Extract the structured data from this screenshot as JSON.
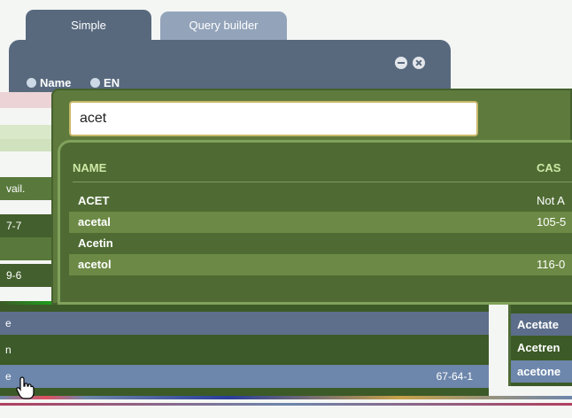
{
  "tabs": [
    {
      "label": "Simple",
      "active": true
    },
    {
      "label": "Query builder",
      "active": false
    }
  ],
  "panel": {
    "radio_options": [
      "Name",
      "EN"
    ],
    "minimize_icon": "minus-circle-icon",
    "close_icon": "close-circle-icon"
  },
  "search": {
    "value": "acet"
  },
  "results": {
    "columns": [
      "NAME",
      "CAS"
    ],
    "rows": [
      {
        "name": "ACET",
        "cas": "Not A"
      },
      {
        "name": "acetal",
        "cas": "105-5"
      },
      {
        "name": "Acetin",
        "cas": ""
      },
      {
        "name": "acetol",
        "cas": "116-0"
      }
    ]
  },
  "background_table": {
    "left_cells": [
      "vail.",
      "7-7",
      "",
      "9-6"
    ]
  },
  "bottom_left": {
    "rows": [
      {
        "left": "e",
        "right": ""
      },
      {
        "left": "n",
        "right": ""
      },
      {
        "left": "e",
        "right": "67-64-1"
      }
    ]
  },
  "bottom_right": {
    "rows": [
      "Acetate",
      "Acetren",
      "acetone"
    ]
  },
  "colors": {
    "tab_active": "#58697e",
    "tab_inactive": "#93a4ba",
    "dropdown_bg": "#5e7a3d",
    "header_text": "#cfe8a6",
    "selected_row": "#6d86ab"
  }
}
